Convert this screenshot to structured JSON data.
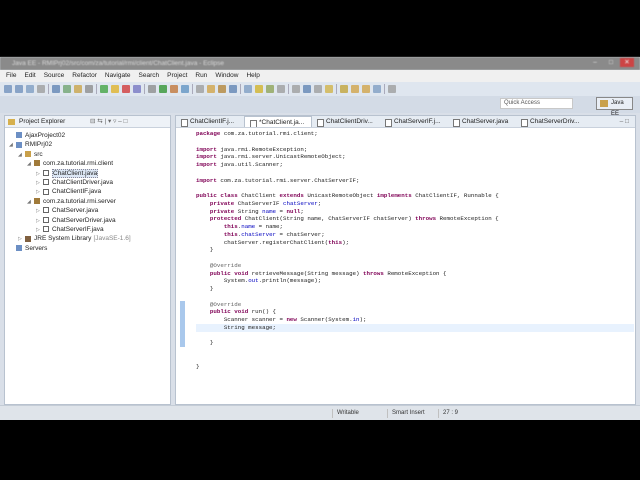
{
  "window": {
    "title": "Java EE - RMIPrj02/src/com/za/tutorial/rmi/client/ChatClient.java - Eclipse",
    "controls": [
      "–",
      "□",
      "✕"
    ]
  },
  "menu": [
    "File",
    "Edit",
    "Source",
    "Refactor",
    "Navigate",
    "Search",
    "Project",
    "Run",
    "Window",
    "Help"
  ],
  "quick_access": {
    "placeholder": "Quick Access"
  },
  "perspective": "Java EE",
  "explorer": {
    "title": "Project Explorer",
    "items": [
      {
        "label": "AjaxProject02",
        "depth": 1,
        "icon": "project-icon"
      },
      {
        "label": "RMIPrj02",
        "depth": 1,
        "icon": "project-icon",
        "expanded": true
      },
      {
        "label": "src",
        "depth": 2,
        "icon": "source-folder-icon",
        "expanded": true
      },
      {
        "label": "com.za.tutorial.rmi.client",
        "depth": 3,
        "icon": "package-icon",
        "expanded": true
      },
      {
        "label": "ChatClient.java",
        "depth": 4,
        "icon": "java-file-icon",
        "selected": true
      },
      {
        "label": "ChatClientDriver.java",
        "depth": 4,
        "icon": "java-file-icon"
      },
      {
        "label": "ChatClientIF.java",
        "depth": 4,
        "icon": "java-file-icon"
      },
      {
        "label": "com.za.tutorial.rmi.server",
        "depth": 3,
        "icon": "package-icon",
        "expanded": true
      },
      {
        "label": "ChatServer.java",
        "depth": 4,
        "icon": "java-file-icon"
      },
      {
        "label": "ChatServerDriver.java",
        "depth": 4,
        "icon": "java-file-icon"
      },
      {
        "label": "ChatServerIF.java",
        "depth": 4,
        "icon": "java-file-icon"
      },
      {
        "label": "JRE System Library",
        "suffix": "[JavaSE-1.6]",
        "depth": 2,
        "icon": "library-icon"
      },
      {
        "label": "Servers",
        "depth": 1,
        "icon": "project-icon"
      }
    ]
  },
  "editor": {
    "tabs": [
      "ChatClientIF.j...",
      "*ChatClient.ja...",
      "ChatClientDriv...",
      "ChatServerIF.j...",
      "ChatServer.java",
      "ChatServerDriv..."
    ],
    "active_tab": 1,
    "code": [
      [
        [
          "package",
          "kw"
        ],
        [
          " com.za.tutorial.rmi.client;",
          ""
        ]
      ],
      [],
      [
        [
          "import",
          "kw"
        ],
        [
          " java.rmi.RemoteException;",
          ""
        ]
      ],
      [
        [
          "import",
          "kw"
        ],
        [
          " java.rmi.server.UnicastRemoteObject;",
          ""
        ]
      ],
      [
        [
          "import",
          "kw"
        ],
        [
          " java.util.Scanner;",
          ""
        ]
      ],
      [],
      [
        [
          "import",
          "kw"
        ],
        [
          " com.za.tutorial.rmi.server.ChatServerIF;",
          ""
        ]
      ],
      [],
      [
        [
          "public class",
          "kw"
        ],
        [
          " ChatClient ",
          ""
        ],
        [
          "extends",
          "kw"
        ],
        [
          " UnicastRemoteObject ",
          ""
        ],
        [
          "implements",
          "kw"
        ],
        [
          " ChatClientIF, Runnable {",
          ""
        ]
      ],
      [
        [
          "    private",
          "kw"
        ],
        [
          " ChatServerIF ",
          ""
        ],
        [
          "chatServer",
          "fld"
        ],
        [
          ";",
          ""
        ]
      ],
      [
        [
          "    private",
          "kw"
        ],
        [
          " String ",
          ""
        ],
        [
          "name",
          "fld"
        ],
        [
          " = ",
          ""
        ],
        [
          "null",
          "kw"
        ],
        [
          ";",
          ""
        ]
      ],
      [
        [
          "    protected",
          "kw"
        ],
        [
          " ChatClient(String name, ChatServerIF chatServer) ",
          ""
        ],
        [
          "throws",
          "kw"
        ],
        [
          " RemoteException {",
          ""
        ]
      ],
      [
        [
          "        this",
          "kw"
        ],
        [
          ".",
          ""
        ],
        [
          "name",
          "fld"
        ],
        [
          " = name;",
          ""
        ]
      ],
      [
        [
          "        this",
          "kw"
        ],
        [
          ".",
          ""
        ],
        [
          "chatServer",
          "fld"
        ],
        [
          " = chatServer;",
          ""
        ]
      ],
      [
        [
          "        chatServer.registerChatClient(",
          ""
        ],
        [
          "this",
          "kw"
        ],
        [
          ");",
          ""
        ]
      ],
      [
        [
          "    }",
          ""
        ]
      ],
      [],
      [
        [
          "    @Override",
          "ann"
        ]
      ],
      [
        [
          "    public void",
          "kw"
        ],
        [
          " retrieveMessage(String message) ",
          ""
        ],
        [
          "throws",
          "kw"
        ],
        [
          " RemoteException {",
          ""
        ]
      ],
      [
        [
          "        System.",
          ""
        ],
        [
          "out",
          "fld"
        ],
        [
          ".println(message);",
          ""
        ]
      ],
      [
        [
          "    }",
          ""
        ]
      ],
      [],
      [
        [
          "    @Override",
          "ann"
        ]
      ],
      [
        [
          "    public void",
          "kw"
        ],
        [
          " run() {",
          ""
        ]
      ],
      [
        [
          "        Scanner scanner = ",
          ""
        ],
        [
          "new",
          "kw"
        ],
        [
          " Scanner(System.",
          ""
        ],
        [
          "in",
          "fld"
        ],
        [
          ");",
          ""
        ]
      ],
      [
        [
          "        String message;",
          ""
        ]
      ],
      [
        [
          "        ",
          ""
        ]
      ],
      [
        [
          "    }",
          ""
        ]
      ],
      [],
      [],
      [
        [
          "}",
          ""
        ]
      ]
    ]
  },
  "status": {
    "mode": "Writable",
    "insert": "Smart Insert",
    "position": "27 : 9"
  }
}
